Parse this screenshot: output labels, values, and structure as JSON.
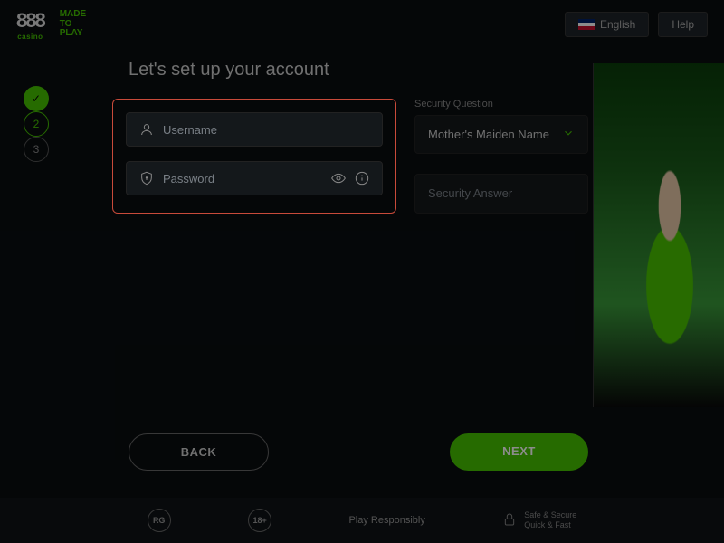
{
  "header": {
    "logo_sub": "casino",
    "logo_tag": "MADE\nTO\nPLAY",
    "lang": "English",
    "help": "Help"
  },
  "stepper": {
    "done_check": "✓",
    "step2": "2",
    "step3": "3"
  },
  "title": "Let's set up your account",
  "form": {
    "username_placeholder": "Username",
    "password_placeholder": "Password",
    "security_label": "Security Question",
    "security_selected": "Mother's Maiden Name",
    "answer_placeholder": "Security Answer"
  },
  "buttons": {
    "back": "BACK",
    "next": "NEXT"
  },
  "footer": {
    "rg": "RG",
    "age": "18+",
    "responsible": "Play Responsibly",
    "secure1": "Safe & Secure",
    "secure2": "Quick & Fast"
  }
}
